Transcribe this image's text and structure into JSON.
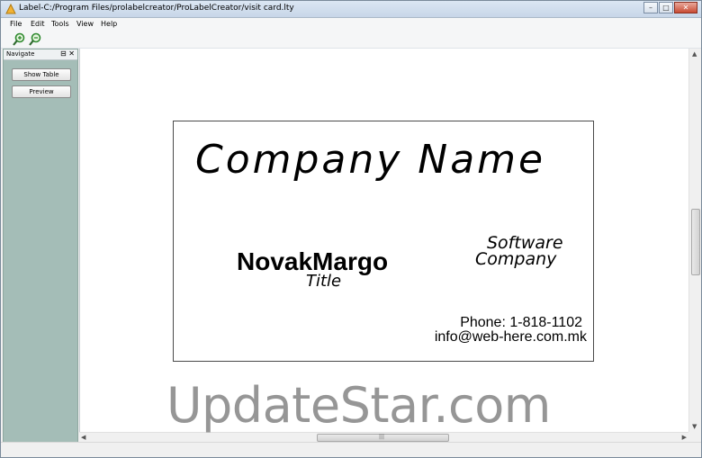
{
  "window": {
    "title": "Label-C:/Program Files/prolabelcreator/ProLabelCreator/visit card.lty",
    "min_glyph": "–",
    "max_glyph": "□",
    "close_glyph": "✕"
  },
  "menu": {
    "items": [
      {
        "label": "File"
      },
      {
        "label": "Edit"
      },
      {
        "label": "Tools"
      },
      {
        "label": "View"
      },
      {
        "label": "Help"
      }
    ]
  },
  "toolbar": {
    "tools": [
      {
        "icon": "zoom-in-icon"
      },
      {
        "icon": "zoom-out-icon"
      }
    ]
  },
  "navigate": {
    "title": "Navigate",
    "pin_glyph": "⊟",
    "close_glyph": "✕",
    "show_table_label": "Show Table",
    "preview_label": "Preview"
  },
  "card": {
    "company_name": "Company Name",
    "person_name": "NovakMargo",
    "person_title": "Title",
    "tagline_1": "Software",
    "tagline_2": "Company",
    "phone": "Phone:  1-818-1102",
    "email": "info@web-here.com.mk"
  },
  "scrollbar": {
    "h_grip": "|||"
  },
  "watermark": {
    "text": "UpdateStar.com"
  },
  "colors": {
    "nav_panel": "#a4bdb7",
    "canvas": "#ffffff",
    "titlebar": "#c7d6e8"
  }
}
